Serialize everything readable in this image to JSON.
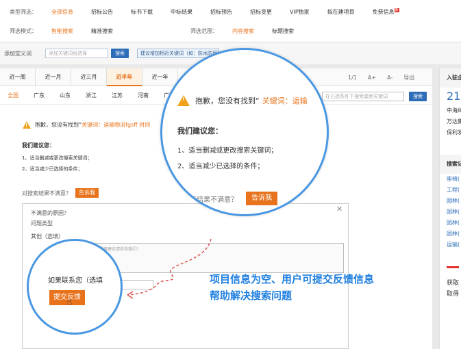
{
  "filters": {
    "row1_label": "类型筛选：",
    "row1_options": [
      "全部信息",
      "招标公告",
      "标书下载",
      "中标结果",
      "招标预告",
      "招标变更",
      "VIP独家",
      "拟在建项目"
    ],
    "free_info": "免费信息",
    "free_badge": "新",
    "row2_label": "筛选模式：",
    "row2_options": [
      "智能搜索",
      "精准搜索"
    ],
    "row2_scope_label": "筛选范围：",
    "row2_scope_options": [
      "内容搜索",
      "标题搜索"
    ]
  },
  "keyword": {
    "label": "添加定义词",
    "placeholder": "添加关键词组选择",
    "search_button": "搜索",
    "suggest": "建议增加相近关键词（如：防水防腐）"
  },
  "tabs": [
    "近一周",
    "近一月",
    "近三月",
    "近半年",
    "近一年"
  ],
  "tools": {
    "page": "1/1",
    "font_up": "A+",
    "font_down": "A-",
    "export": "导出"
  },
  "regions": [
    "全国",
    "广东",
    "山东",
    "浙江",
    "江苏",
    "河南",
    "广西"
  ],
  "search_within": {
    "placeholder": "在已选条件下搜索其他关键词",
    "button": "搜索"
  },
  "notice": {
    "prefix": "抱歉，您没有找到“",
    "keyword_label": "关键词：运输",
    "keyword_rest": " 物流fgsff 时间",
    "suggest_title": "我们建议您：",
    "tip1": "1、适当删减或更改搜索关键词；",
    "tip2": "2、适当减少已选择的条件；",
    "unsatisfied": "对搜索结果不满意？",
    "tell_us": "告诉我"
  },
  "feedback": {
    "reason": "不满意的原因？",
    "type_label": "问题类型",
    "other_label": "其他（选填）",
    "placeholder": "遇到任何问题，意见或者建议请告诉我们！\n告诉我们！请有反馈！",
    "contact_label": "如果联系您（选填）",
    "submit": "提交反馈"
  },
  "zoom": {
    "sorry": "抱歉，您没有找到“",
    "keyword": "关键词：运输",
    "suggest_title": "我们建议您：",
    "tip1": "1、适当删减或更改搜索关键词；",
    "tip2": "2、适当减少已选择的条件；",
    "unsatisfied": "搜索结果不满意？",
    "tell_us": "告诉我",
    "contact_label": "如果联系您（选填",
    "submit": "提交反馈"
  },
  "annotation": {
    "line1": "项目信息为空、用户可提交反馈信息",
    "line2": "帮助解决搜索问题"
  },
  "sidebar": {
    "title": "入驻企",
    "numbers": "21",
    "companies": [
      "中海纠",
      "万达集",
      "保利发"
    ],
    "section2": "搜索记",
    "links": [
      "座椅(",
      "工程(",
      "园林(",
      "园林(",
      "园林(",
      "园林(",
      "运输("
    ],
    "bottom1": "获取",
    "bottom2": "取得"
  },
  "colors": {
    "accent": "#e8731c",
    "link": "#2d6db8",
    "annot": "#1f7fe0",
    "ring": "#4a97e2"
  }
}
